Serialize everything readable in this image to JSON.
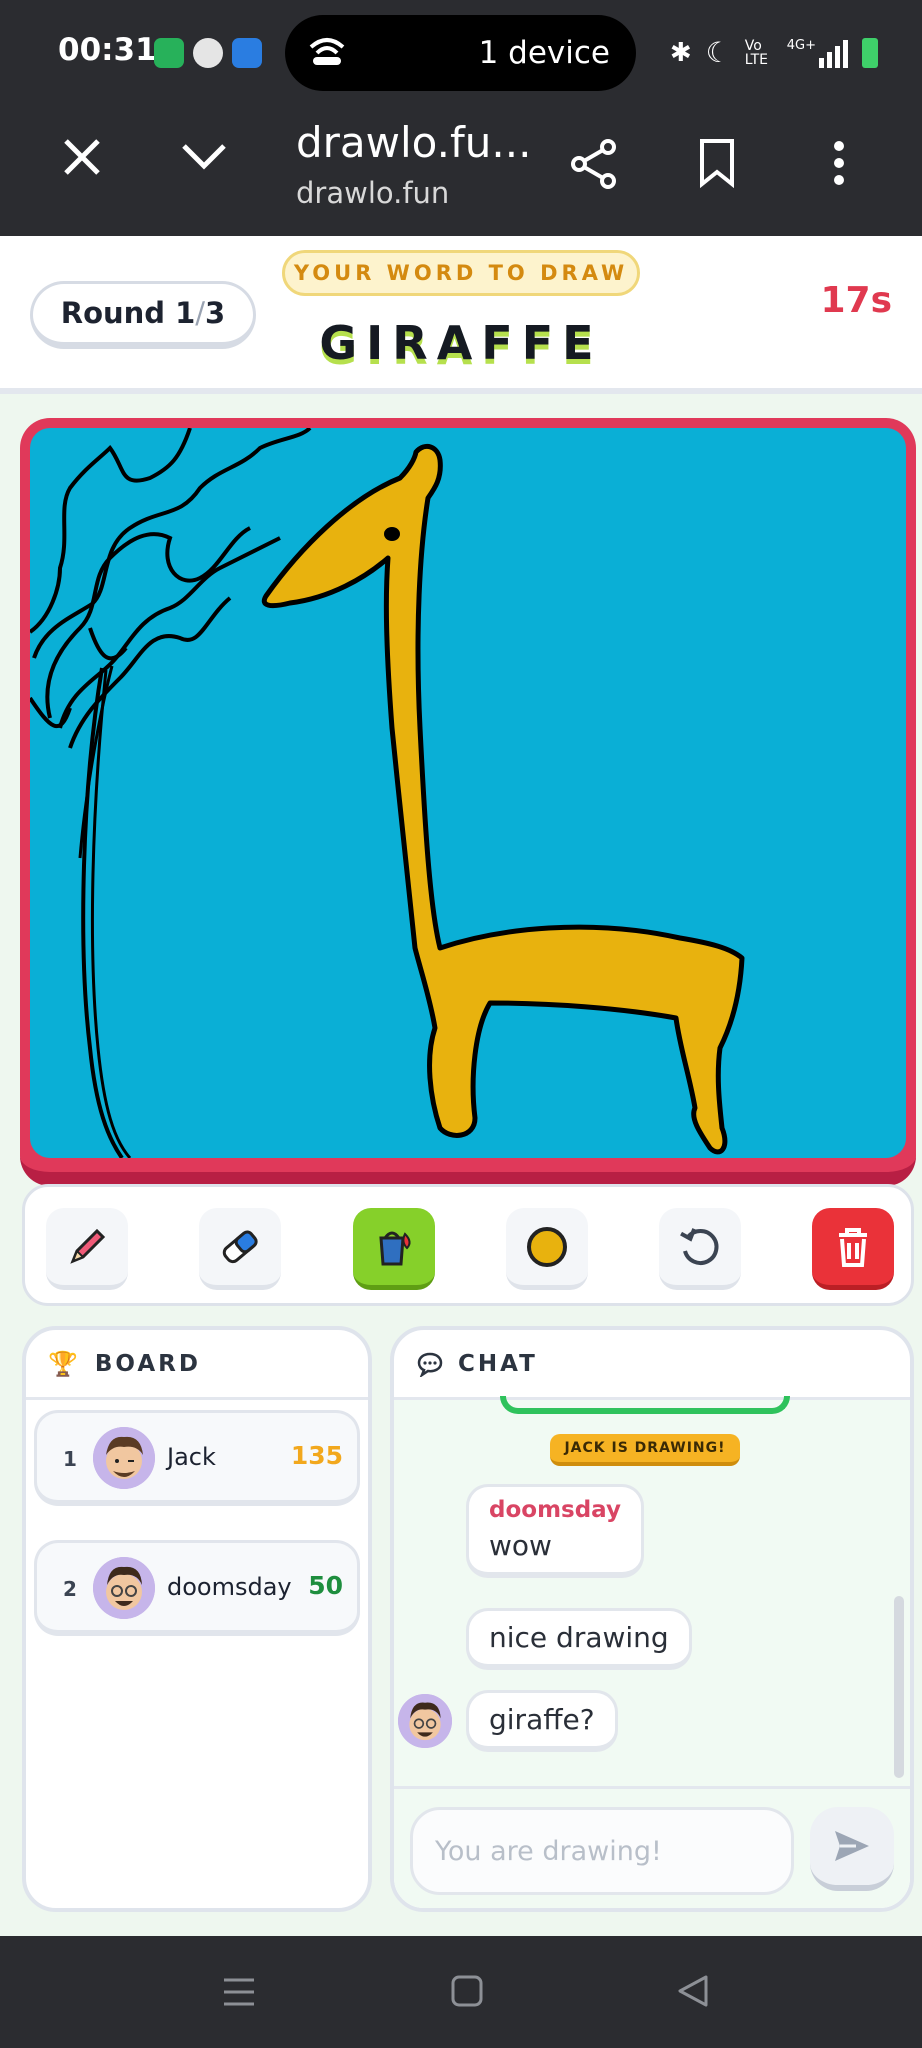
{
  "status_bar": {
    "time": "00:31",
    "pill_label": "1 device",
    "icons": [
      "battery-saver-icon",
      "vpn-icon",
      "android-icon",
      "bluetooth-icon",
      "moon-icon",
      "volte-icon",
      "signal-icon",
      "battery-charging-icon"
    ],
    "network": "4G+",
    "volte": "Vo LTE"
  },
  "browser": {
    "title": "drawlo.fu...",
    "url": "drawlo.fun",
    "icons": [
      "close-icon",
      "chevron-down-icon",
      "share-icon",
      "bookmark-icon",
      "more-vertical-icon"
    ]
  },
  "game": {
    "round_label": "Round",
    "round_current": "1",
    "round_sep": "/",
    "round_total": "3",
    "word_tag": "YOUR WORD TO DRAW",
    "word": "GIRAFFE",
    "timer": "17s",
    "colors": {
      "frame": "#e0395a",
      "canvas_bg": "#0aafd6",
      "giraffe_fill": "#e8b20e"
    }
  },
  "toolbar": {
    "tools": [
      "pencil-icon",
      "eraser-icon",
      "paint-bucket-icon",
      "color-swatch-icon",
      "undo-icon",
      "trash-icon"
    ],
    "active_tool": "paint-bucket",
    "selected_color": "#e8b20e"
  },
  "board": {
    "title": "BOARD",
    "players": [
      {
        "rank": "1",
        "name": "Jack",
        "score": "135",
        "score_color": "#f2a81d"
      },
      {
        "rank": "2",
        "name": "doomsday",
        "score": "50",
        "score_color": "#1e8e3e"
      }
    ]
  },
  "chat": {
    "title": "CHAT",
    "system_message": "JACK IS DRAWING!",
    "messages": [
      {
        "author": "doomsday",
        "text": "wow"
      },
      {
        "author": "",
        "text": "nice drawing"
      },
      {
        "author": "",
        "text": "giraffe?"
      }
    ],
    "input_placeholder": "You are drawing!"
  }
}
